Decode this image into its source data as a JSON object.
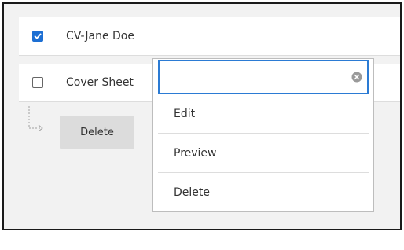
{
  "files": [
    {
      "label": "CV-Jane Doe",
      "checked": true
    },
    {
      "label": "Cover Sheet",
      "checked": false
    }
  ],
  "actions": {
    "delete_label": "Delete"
  },
  "dropdown": {
    "search_value": "",
    "items": [
      {
        "label": "Edit"
      },
      {
        "label": "Preview"
      },
      {
        "label": "Delete"
      }
    ]
  },
  "colors": {
    "accent": "#1d6fd3",
    "search_border": "#2b7bd4",
    "panel_bg": "#f2f2f2",
    "button_bg": "#dcdcdc"
  },
  "icons": {
    "checkbox_checked": "checkmark-icon",
    "clear": "clear-circle-x-icon",
    "tree": "tree-branch-arrow-icon"
  }
}
